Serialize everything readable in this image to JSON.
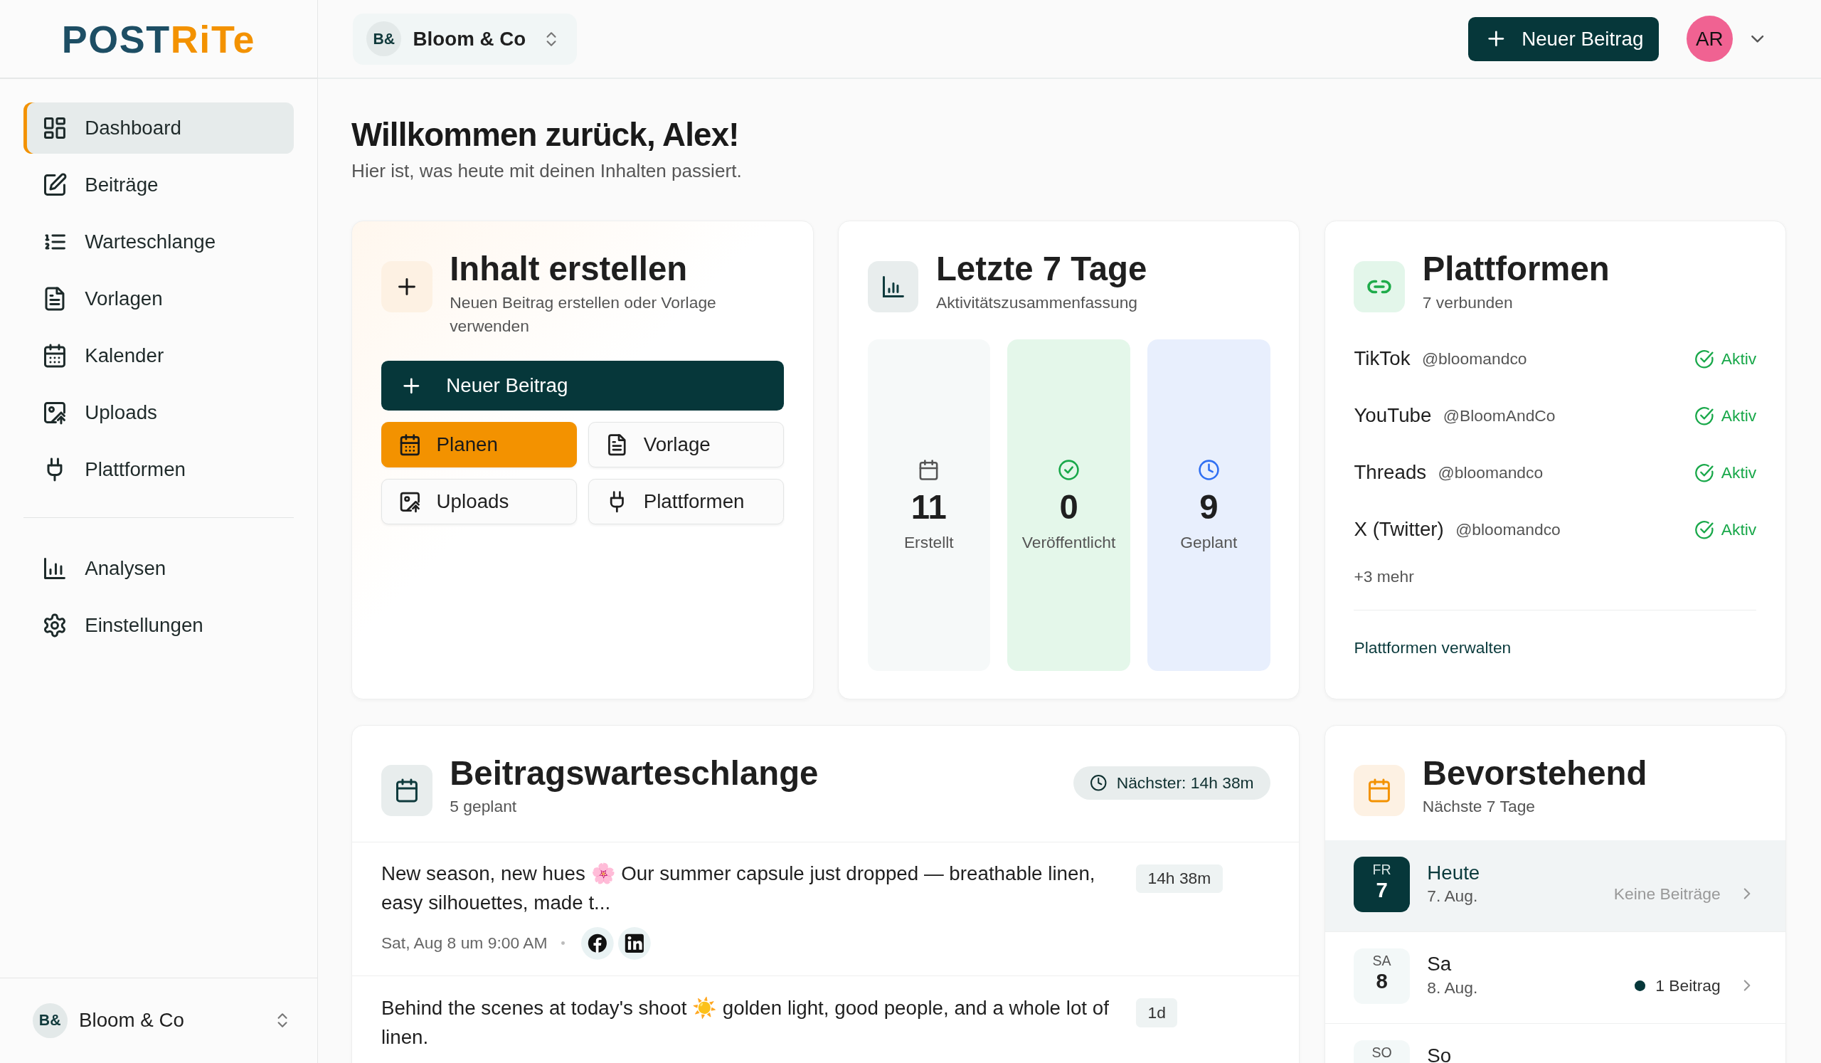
{
  "logo": [
    {
      "text": "POST",
      "color": "#1d4e64"
    },
    {
      "text": "RiTe",
      "color": "#f39200"
    }
  ],
  "sidebar": {
    "items": [
      {
        "label": "Dashboard",
        "selected": true
      },
      {
        "label": "Beiträge",
        "selected": false
      },
      {
        "label": "Warteschlange",
        "selected": false
      },
      {
        "label": "Vorlagen",
        "selected": false
      },
      {
        "label": "Kalender",
        "selected": false
      },
      {
        "label": "Uploads",
        "selected": false
      },
      {
        "label": "Plattformen",
        "selected": false
      }
    ],
    "items_2": [
      {
        "label": "Analysen",
        "selected": false
      },
      {
        "label": "Einstellungen",
        "selected": false
      }
    ],
    "workspace": {
      "initials": "B&",
      "name": "Bloom & Co"
    }
  },
  "header": {
    "workspace": {
      "initials": "B&",
      "name": "Bloom & Co"
    },
    "new_post_button": "Neuer Beitrag",
    "avatar": "AR"
  },
  "welcome": {
    "title": "Willkommen zurück, Alex!",
    "subtitle": "Hier ist, was heute mit deinen Inhalten passiert."
  },
  "create_card": {
    "title": "Inhalt erstellen",
    "subtitle": "Neuen Beitrag erstellen oder Vorlage verwenden",
    "primary_button": "Neuer Beitrag",
    "actions": [
      {
        "label": "Planen",
        "kind": "accent"
      },
      {
        "label": "Vorlage",
        "kind": "outline"
      },
      {
        "label": "Uploads",
        "kind": "outline"
      },
      {
        "label": "Plattformen",
        "kind": "outline"
      }
    ]
  },
  "stats_card": {
    "title": "Letzte 7 Tage",
    "subtitle": "Aktivitätszusammenfassung",
    "stats": [
      {
        "value": "11",
        "label": "Erstellt",
        "kind": "created"
      },
      {
        "value": "0",
        "label": "Veröffentlicht",
        "kind": "published"
      },
      {
        "value": "9",
        "label": "Geplant",
        "kind": "scheduled"
      }
    ]
  },
  "platforms_card": {
    "title": "Plattformen",
    "subtitle": "7 verbunden",
    "platforms": [
      {
        "name": "TikTok",
        "handle": "@bloomandco",
        "status": "Aktiv"
      },
      {
        "name": "YouTube",
        "handle": "@BloomAndCo",
        "status": "Aktiv"
      },
      {
        "name": "Threads",
        "handle": "@bloomandco",
        "status": "Aktiv"
      },
      {
        "name": "X (Twitter)",
        "handle": "@bloomandco",
        "status": "Aktiv"
      }
    ],
    "more": "+3 mehr",
    "manage_link": "Plattformen verwalten"
  },
  "queue_card": {
    "title": "Beitragswarteschlange",
    "subtitle": "5 geplant",
    "next_badge": "Nächster: 14h 38m",
    "posts": [
      {
        "text": "New season, new hues 🌸  Our summer capsule just dropped — breathable linen, easy silhouettes, made t...",
        "badge": "14h 38m",
        "meta": "Sat, Aug 8 um 9:00 AM",
        "networks": [
          {
            "kind": "facebook"
          },
          {
            "kind": "linkedin"
          }
        ]
      },
      {
        "text": "Behind the scenes at today's shoot ☀️  golden light, good people, and a whole lot of linen.",
        "badge": "1d"
      }
    ]
  },
  "upcoming_card": {
    "title": "Bevorstehend",
    "subtitle": "Nächste 7 Tage",
    "days": [
      {
        "weekday": "FR",
        "day": "7",
        "name": "Heute",
        "date": "7. Aug.",
        "summary": "Keine Beiträge",
        "has_posts": false,
        "today": true
      },
      {
        "weekday": "SA",
        "day": "8",
        "name": "Sa",
        "date": "8. Aug.",
        "summary": "1 Beitrag",
        "has_posts": true,
        "today": false
      },
      {
        "weekday": "SO",
        "name": "So",
        "today": false
      }
    ]
  }
}
